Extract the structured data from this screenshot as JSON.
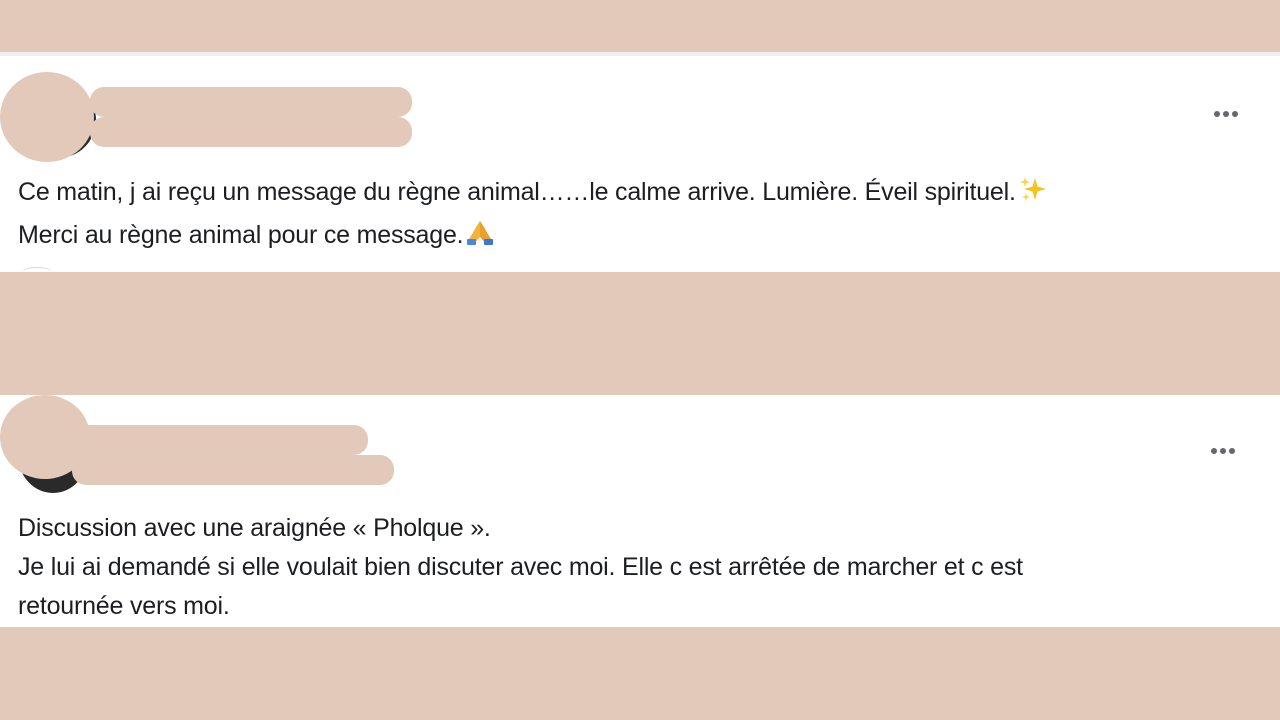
{
  "feed": {
    "posts": [
      {
        "author_name": "",
        "author_meta": "",
        "body_lines": [
          "Ce matin, j ai reçu un message du règne animal……le calme arrive. Lumière. Éveil spirituel.",
          "Merci au règne animal pour ce message."
        ],
        "emojis": [
          "sparkles",
          "folded-hands"
        ],
        "more_options_icon": "ellipsis-horizontal-icon"
      },
      {
        "author_name": "",
        "author_meta": "",
        "body_lines": [
          "Discussion avec une araignée « Pholque ».",
          "Je lui ai demandé si elle voulait bien discuter avec moi. Elle c est arrêtée de marcher et c est",
          "retournée vers moi."
        ],
        "more_options_icon": "ellipsis-horizontal-icon"
      }
    ]
  },
  "colors": {
    "background_mask": "#e2c9b9",
    "card": "#ffffff",
    "text": "#1c1e21",
    "icon_gray": "#65676b"
  }
}
